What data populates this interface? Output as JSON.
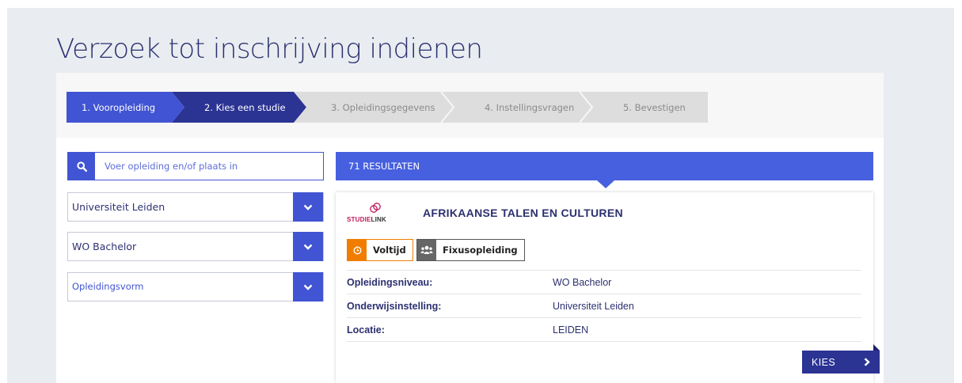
{
  "page": {
    "title": "Verzoek tot inschrijving indienen"
  },
  "steps": [
    {
      "label": "1. Vooropleiding",
      "state": "done"
    },
    {
      "label": "2. Kies een studie",
      "state": "active"
    },
    {
      "label": "3. Opleidingsgegevens",
      "state": "todo"
    },
    {
      "label": "4. Instellingsvragen",
      "state": "todo"
    },
    {
      "label": "5. Bevestigen",
      "state": "todo"
    }
  ],
  "search": {
    "placeholder": "Voer opleiding en/of plaats in",
    "value": "",
    "icon": "search-icon"
  },
  "filters": {
    "institution": "Universiteit Leiden",
    "level": "WO Bachelor",
    "form_placeholder": "Opleidingsvorm"
  },
  "results": {
    "count_label": "71 RESULTATEN"
  },
  "result_card": {
    "logo_text_a": "STUDIE",
    "logo_text_b": "LINK",
    "title": "AFRIKAANSE TALEN EN CULTUREN",
    "tags": [
      "Voltijd",
      "Fixusopleiding"
    ],
    "rows": [
      {
        "label": "Opleidingsniveau:",
        "value": "WO Bachelor"
      },
      {
        "label": "Onderwijsinstelling:",
        "value": "Universiteit Leiden"
      },
      {
        "label": "Locatie:",
        "value": "LEIDEN"
      }
    ],
    "action_label": "KIES"
  },
  "colors": {
    "primary": "#4154d3",
    "dark": "#2b3393",
    "header": "#4760e0",
    "title": "#2c3170",
    "orange": "#f07d00",
    "brand_pink": "#c2185b"
  }
}
